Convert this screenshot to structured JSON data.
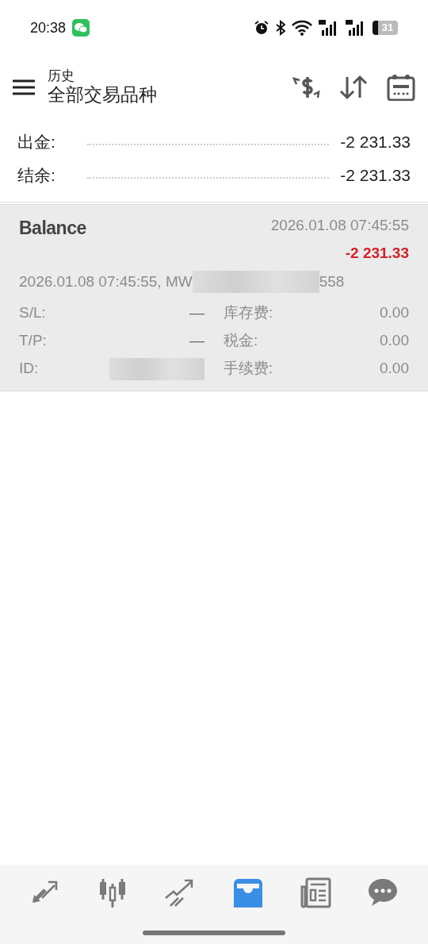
{
  "status_bar": {
    "time": "20:38",
    "battery": "31"
  },
  "header": {
    "title": "历史",
    "subtitle": "全部交易品种"
  },
  "summary": [
    {
      "label": "出金:",
      "value": "-2 231.33"
    },
    {
      "label": "结余:",
      "value": "-2 231.33"
    }
  ],
  "deal": {
    "type": "Balance",
    "time": "2026.01.08 07:45:55",
    "amount": "-2 231.33",
    "comment": "2026.01.08 07:45:55, MW",
    "comment_tail": "558",
    "fields": [
      {
        "label": "S/L:",
        "value": "—",
        "label2": "库存费:",
        "value2": "0.00"
      },
      {
        "label": "T/P:",
        "value": "—",
        "label2": "税金:",
        "value2": "0.00"
      },
      {
        "label": "ID:",
        "redacted": true,
        "label2": "手续费:",
        "value2": "0.00"
      }
    ]
  },
  "tabs": [
    {
      "kind": "trade",
      "selected": false
    },
    {
      "kind": "chart",
      "selected": false
    },
    {
      "kind": "trend",
      "selected": false
    },
    {
      "kind": "history",
      "selected": true
    },
    {
      "kind": "news",
      "selected": false
    },
    {
      "kind": "chat",
      "selected": false
    }
  ]
}
